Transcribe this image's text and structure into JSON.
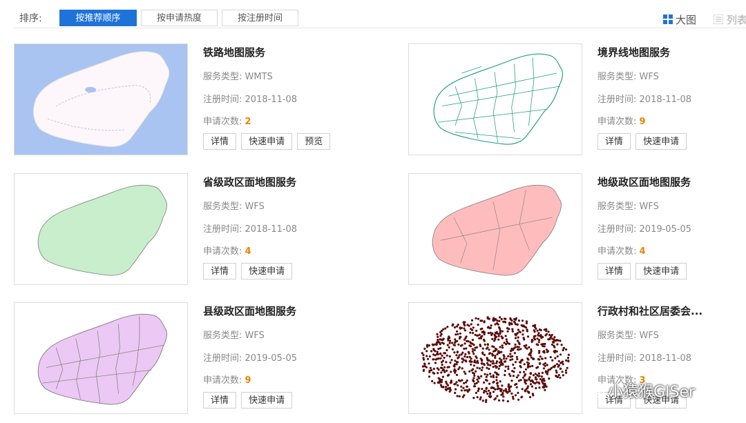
{
  "sortbar": {
    "label": "排序:",
    "options": [
      {
        "label": "按推荐顺序",
        "active": true
      },
      {
        "label": "按申请热度",
        "active": false
      },
      {
        "label": "按注册时间",
        "active": false
      }
    ],
    "view_big": "大图",
    "view_list": "列表"
  },
  "labels": {
    "type": "服务类型:",
    "date": "注册时间:",
    "count": "申请次数:"
  },
  "buttons": {
    "detail": "详情",
    "apply": "快速申请",
    "preview": "预览"
  },
  "cards": [
    {
      "title": "铁路地图服务",
      "type": "WMTS",
      "date": "2018-11-08",
      "count": "2",
      "preview": true,
      "icon": "railway-map"
    },
    {
      "title": "境界线地图服务",
      "type": "WFS",
      "date": "2018-11-08",
      "count": "9",
      "preview": false,
      "icon": "boundary-map"
    },
    {
      "title": "省级政区面地图服务",
      "type": "WFS",
      "date": "2018-11-08",
      "count": "4",
      "preview": false,
      "icon": "province-map"
    },
    {
      "title": "地级政区面地图服务",
      "type": "WFS",
      "date": "2019-05-05",
      "count": "4",
      "preview": false,
      "icon": "prefecture-map"
    },
    {
      "title": "县级政区面地图服务",
      "type": "WFS",
      "date": "2019-05-05",
      "count": "9",
      "preview": false,
      "icon": "county-map"
    },
    {
      "title": "行政村和社区居委会...",
      "type": "WFS",
      "date": "2018-11-08",
      "count": "3",
      "preview": false,
      "icon": "village-map"
    }
  ],
  "colors": {
    "accent": "#1e73d9",
    "count": "#f08200",
    "ocean": "#a9c4f0",
    "province_fill": "#c8eecb",
    "prefecture_fill": "#ffbcbc",
    "county_fill": "#ecc8f4",
    "boundary_stroke": "#1aa07a",
    "village_points": "#5a0a0a"
  },
  "watermark": "小猿猴GISer"
}
